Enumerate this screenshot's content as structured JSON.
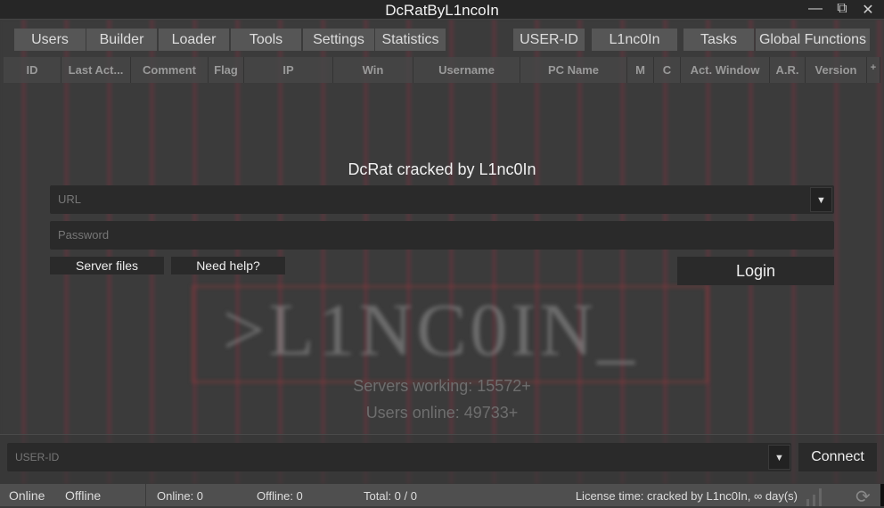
{
  "window": {
    "title": "DcRatByL1ncoIn",
    "minimize_icon": "minimize-icon",
    "restore_icon": "restore-icon",
    "close_icon": "close-icon"
  },
  "tabs_left": [
    "Users",
    "Builder",
    "Loader",
    "Tools",
    "Settings",
    "Statistics"
  ],
  "tabs_right": [
    "USER-ID",
    "L1nc0In",
    "Tasks",
    "Global Functions"
  ],
  "columns": [
    "ID",
    "Last Act...",
    "Comment",
    "Flag",
    "IP",
    "Win",
    "Username",
    "PC Name",
    "M",
    "C",
    "Act. Window",
    "A.R.",
    "Version",
    "+"
  ],
  "background_logo": ">L1NC0IN_",
  "login": {
    "heading": "DcRat cracked by L1nc0In",
    "url_placeholder": "URL",
    "password_placeholder": "Password",
    "server_files": "Server files",
    "need_help": "Need help?",
    "login_button": "Login"
  },
  "stats": {
    "servers": "Servers working: 15572+",
    "users": "Users online: 49733+"
  },
  "connect": {
    "userid_placeholder": "USER-ID",
    "connect_button": "Connect"
  },
  "status": {
    "online_tab": "Online",
    "offline_tab": "Offline",
    "online": "Online: 0",
    "offline": "Offline: 0",
    "total": "Total: 0 / 0",
    "license": "License time: cracked by L1nc0In, ∞ day(s)"
  }
}
